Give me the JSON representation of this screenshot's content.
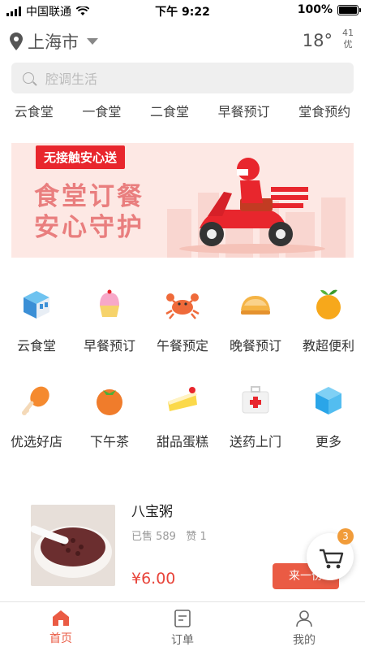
{
  "status_bar": {
    "carrier": "中国联通",
    "time": "下午 9:22",
    "battery": "100%"
  },
  "header": {
    "city": "上海市",
    "temperature": "18°",
    "aqi_value": "41",
    "aqi_label": "优"
  },
  "search": {
    "placeholder": "腔调生活"
  },
  "tabs": [
    {
      "label": "云食堂"
    },
    {
      "label": "一食堂"
    },
    {
      "label": "二食堂"
    },
    {
      "label": "早餐预订"
    },
    {
      "label": "堂食预约"
    }
  ],
  "banner": {
    "tag": "无接触安心送",
    "line1": "食堂订餐",
    "line2": "安心守护"
  },
  "categories": [
    {
      "label": "云食堂",
      "icon": "building-icon"
    },
    {
      "label": "早餐预订",
      "icon": "cupcake-icon"
    },
    {
      "label": "午餐预定",
      "icon": "crab-icon"
    },
    {
      "label": "晚餐预订",
      "icon": "bun-icon"
    },
    {
      "label": "教超便利",
      "icon": "orange-icon"
    },
    {
      "label": "优选好店",
      "icon": "drumstick-icon"
    },
    {
      "label": "下午茶",
      "icon": "tomato-icon"
    },
    {
      "label": "甜品蛋糕",
      "icon": "cake-icon"
    },
    {
      "label": "送药上门",
      "icon": "medkit-icon"
    },
    {
      "label": "更多",
      "icon": "cube-icon"
    }
  ],
  "product": {
    "name": "八宝粥",
    "sold": "已售 589",
    "likes": "赞 1",
    "price": "¥6.00",
    "button": "来一份"
  },
  "cart": {
    "count": "3"
  },
  "bottom_nav": [
    {
      "label": "首页"
    },
    {
      "label": "订单"
    },
    {
      "label": "我的"
    }
  ],
  "colors": {
    "accent": "#ea5b44",
    "banner_bg": "#fde8e4",
    "tag_red": "#e8262d"
  }
}
